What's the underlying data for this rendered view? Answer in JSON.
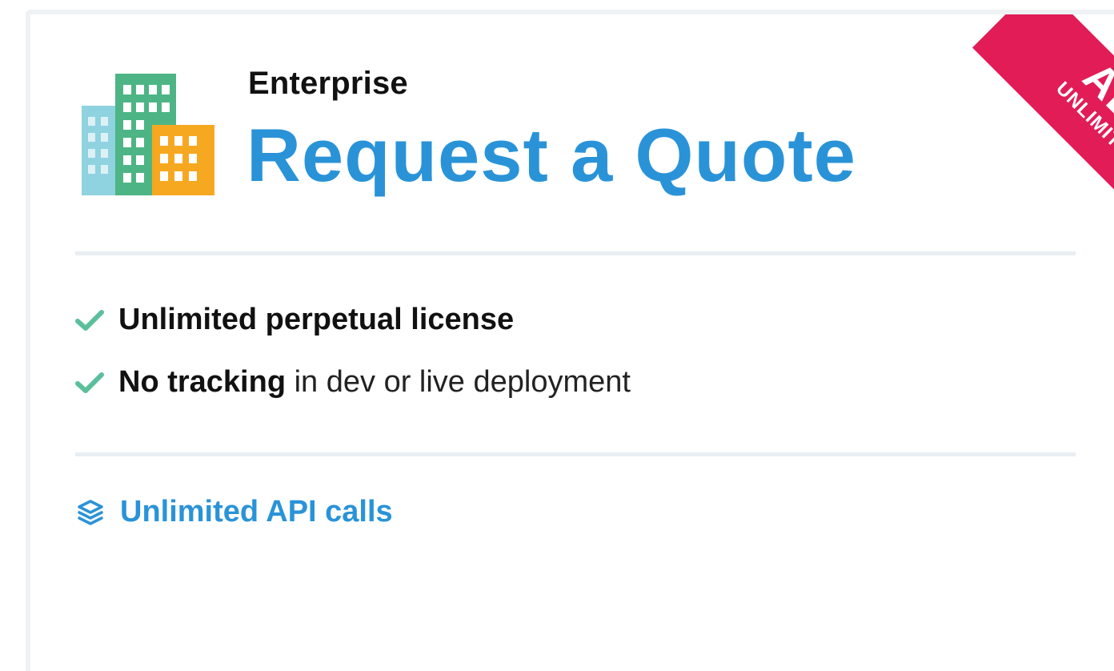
{
  "plan": {
    "tier_label": "Enterprise",
    "headline": "Request a Quote",
    "ribbon": {
      "main": "ALL",
      "sub": "UNLIMITED",
      "color": "#e21c57"
    },
    "icon": "office-buildings-icon"
  },
  "features": [
    {
      "icon": "checkmark-icon",
      "bold": "Unlimited perpetual license",
      "rest": ""
    },
    {
      "icon": "checkmark-icon",
      "bold": "No tracking",
      "rest": " in dev or live deployment"
    }
  ],
  "api": {
    "icon": "layers-icon",
    "label": "Unlimited API calls"
  },
  "colors": {
    "accent": "#2a93d8",
    "check": "#5bbf9b",
    "ribbon": "#e21c57"
  }
}
